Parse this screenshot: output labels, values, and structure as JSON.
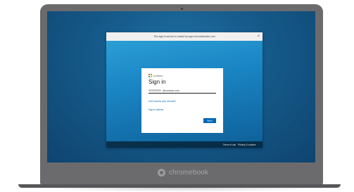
{
  "device": {
    "brand_text": "chromebook"
  },
  "window": {
    "title": "This sign-in service is hosted by login.microsoftonline.com",
    "close_glyph": "×",
    "footer": {
      "terms": "Terms of use",
      "privacy": "Privacy & cookies",
      "more": "..."
    }
  },
  "signin": {
    "brand_name": "contoso",
    "heading": "Sign in",
    "email_suffix": "@contoso.com",
    "cant_access": "Can't access your account?",
    "sign_in_options": "Sign-in options",
    "next_label": "Next"
  },
  "colors": {
    "accent": "#0067b8",
    "desktop": "#155a8a",
    "window_gradient_top": "#2ea2d8"
  }
}
